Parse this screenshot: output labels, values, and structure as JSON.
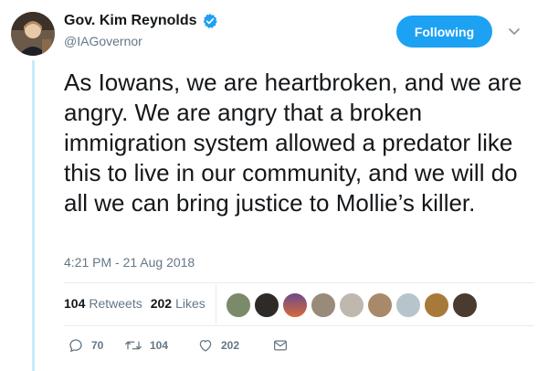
{
  "account": {
    "display_name": "Gov. Kim Reynolds",
    "handle": "@IAGovernor"
  },
  "follow_button": {
    "label": "Following"
  },
  "tweet": {
    "text": "As Iowans, we are heartbroken, and we are angry. We are angry that a broken immigration system allowed a predator like this to live in our community, and we will do all we can bring justice to Mollie’s killer.",
    "timestamp": "4:21 PM - 21 Aug 2018"
  },
  "stats": {
    "retweets_count": "104",
    "retweets_label": "Retweets",
    "likes_count": "202",
    "likes_label": "Likes"
  },
  "actions": {
    "reply_count": "70",
    "retweet_count": "104",
    "like_count": "202"
  },
  "colors": {
    "brand_blue": "#1da1f2",
    "thread_line": "#c8ecfc",
    "muted_text": "#657786"
  },
  "icons": [
    "verified-badge-icon",
    "chevron-down-icon",
    "reply-icon",
    "retweet-icon",
    "heart-icon",
    "direct-message-icon"
  ]
}
